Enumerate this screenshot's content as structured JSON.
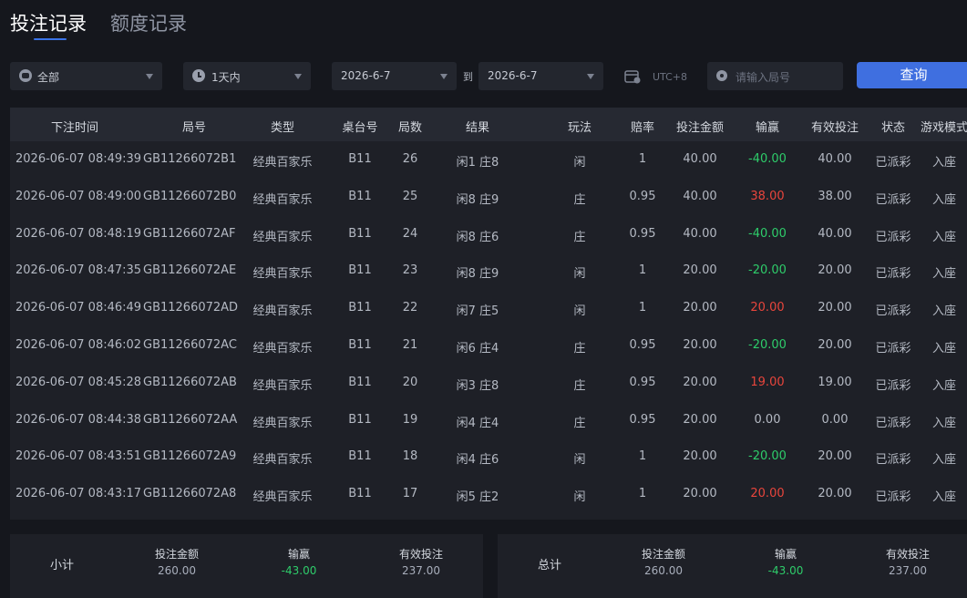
{
  "tabs": {
    "active": "投注记录",
    "inactive": "额度记录"
  },
  "filters": {
    "scope": "全部",
    "period": "1天内",
    "date_from": "2026-6-7",
    "to_label": "到",
    "date_to": "2026-6-7",
    "timezone": "UTC+8",
    "round_placeholder": "请输入局号",
    "query_button": "查询"
  },
  "table": {
    "headers": [
      "下注时间",
      "局号",
      "类型",
      "桌台号",
      "局数",
      "结果",
      "玩法",
      "赔率",
      "投注金额",
      "输赢",
      "有效投注",
      "状态",
      "游戏模式"
    ],
    "rows": [
      [
        "2026-06-07 08:49:39",
        "GB11266072B1",
        "经典百家乐",
        "B11",
        "26",
        "闲1 庄8",
        "闲",
        "1",
        "40.00",
        "-40.00",
        "40.00",
        "已派彩",
        "入座"
      ],
      [
        "2026-06-07 08:49:00",
        "GB11266072B0",
        "经典百家乐",
        "B11",
        "25",
        "闲8 庄9",
        "庄",
        "0.95",
        "40.00",
        "38.00",
        "38.00",
        "已派彩",
        "入座"
      ],
      [
        "2026-06-07 08:48:19",
        "GB11266072AF",
        "经典百家乐",
        "B11",
        "24",
        "闲8 庄6",
        "庄",
        "0.95",
        "40.00",
        "-40.00",
        "40.00",
        "已派彩",
        "入座"
      ],
      [
        "2026-06-07 08:47:35",
        "GB11266072AE",
        "经典百家乐",
        "B11",
        "23",
        "闲8 庄9",
        "闲",
        "1",
        "20.00",
        "-20.00",
        "20.00",
        "已派彩",
        "入座"
      ],
      [
        "2026-06-07 08:46:49",
        "GB11266072AD",
        "经典百家乐",
        "B11",
        "22",
        "闲7 庄5",
        "闲",
        "1",
        "20.00",
        "20.00",
        "20.00",
        "已派彩",
        "入座"
      ],
      [
        "2026-06-07 08:46:02",
        "GB11266072AC",
        "经典百家乐",
        "B11",
        "21",
        "闲6 庄4",
        "庄",
        "0.95",
        "20.00",
        "-20.00",
        "20.00",
        "已派彩",
        "入座"
      ],
      [
        "2026-06-07 08:45:28",
        "GB11266072AB",
        "经典百家乐",
        "B11",
        "20",
        "闲3 庄8",
        "庄",
        "0.95",
        "20.00",
        "19.00",
        "19.00",
        "已派彩",
        "入座"
      ],
      [
        "2026-06-07 08:44:38",
        "GB11266072AA",
        "经典百家乐",
        "B11",
        "19",
        "闲4 庄4",
        "庄",
        "0.95",
        "20.00",
        "0.00",
        "0.00",
        "已派彩",
        "入座"
      ],
      [
        "2026-06-07 08:43:51",
        "GB11266072A9",
        "经典百家乐",
        "B11",
        "18",
        "闲4 庄6",
        "闲",
        "1",
        "20.00",
        "-20.00",
        "20.00",
        "已派彩",
        "入座"
      ],
      [
        "2026-06-07 08:43:17",
        "GB11266072A8",
        "经典百家乐",
        "B11",
        "17",
        "闲5 庄2",
        "闲",
        "1",
        "20.00",
        "20.00",
        "20.00",
        "已派彩",
        "入座"
      ]
    ]
  },
  "subtotal": {
    "title": "小计",
    "bet_label": "投注金额",
    "bet_value": "260.00",
    "winloss_label": "输赢",
    "winloss_value": "-43.00",
    "valid_label": "有效投注",
    "valid_value": "237.00"
  },
  "total": {
    "title": "总计",
    "bet_label": "投注金额",
    "bet_value": "260.00",
    "winloss_label": "输赢",
    "winloss_value": "-43.00",
    "valid_label": "有效投注",
    "valid_value": "237.00"
  },
  "colors": {
    "accent": "#3f6fe0",
    "loss": "#2ecc6a",
    "win": "#e8453c"
  },
  "icons": [
    "chip-icon",
    "clock-icon",
    "chevron-down-icon",
    "calendar-icon",
    "round-id-icon"
  ]
}
